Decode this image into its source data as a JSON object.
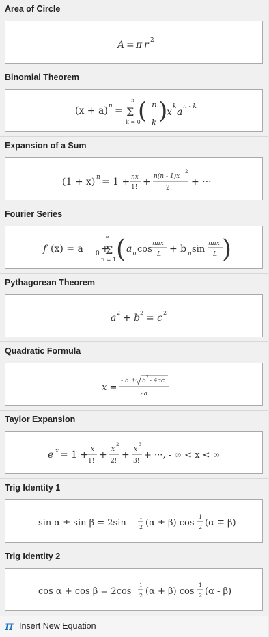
{
  "sections": [
    {
      "title": "Area of Circle"
    },
    {
      "title": "Binomial Theorem"
    },
    {
      "title": "Expansion of a Sum"
    },
    {
      "title": "Fourier Series"
    },
    {
      "title": "Pythagorean Theorem"
    },
    {
      "title": "Quadratic Formula"
    },
    {
      "title": "Taylor Expansion"
    },
    {
      "title": "Trig Identity 1"
    },
    {
      "title": "Trig Identity 2"
    }
  ],
  "equations": {
    "area": {
      "A": "A",
      "eq": "=",
      "pi": "π",
      "r": "r",
      "sq": "2"
    },
    "binomial": {
      "lhs": "(x + a)",
      "n": "n",
      "eq": "=",
      "sigma": "Σ",
      "top": "n",
      "bottom": "k = 0",
      "binom_n": "n",
      "binom_k": "k",
      "x": "x",
      "xexp": "k",
      "a": "a",
      "aexp": "n - k",
      "lp": "(",
      "rp": ")"
    },
    "expansion": {
      "lhs": "(1 + x)",
      "n": "n",
      "eq": "= 1 +",
      "f1n": "nx",
      "f1d": "1!",
      "plus": "+",
      "f2n": "n(n - 1)x",
      "f2sq": "2",
      "f2d": "2!",
      "tail": "+ ···"
    },
    "fourier": {
      "f": "f",
      "arg": "(x) = a",
      "sub0": "0",
      "plus": "+",
      "sigma": "Σ",
      "top": "∞",
      "bottom": "n = 1",
      "a": "a",
      "subn": "n",
      "cos": "cos",
      "frac_n": "nπx",
      "frac_d": "L",
      "plus2": "+ b",
      "subn2": "n",
      "sin": "sin",
      "frac2_n": "nπx",
      "frac2_d": "L",
      "lp": "(",
      "rp": ")"
    },
    "pythagorean": {
      "a": "a",
      "two1": "2",
      "plus": "+ b",
      "two2": "2",
      "eq": "= c",
      "two3": "2"
    },
    "quadratic": {
      "x": "x =",
      "num": "- b ±",
      "rad": "b",
      "radsq": "2",
      "radrest": "- 4ac",
      "den": "2a"
    },
    "taylor": {
      "e": "e",
      "x": "x",
      "eq": "= 1 +",
      "f1n": "x",
      "f1d": "1!",
      "plus": "+",
      "f2n": "x",
      "f2e": "2",
      "f2d": "2!",
      "f3n": "x",
      "f3e": "3",
      "f3d": "3!",
      "tail": "+ ···, - ∞ < x < ∞"
    },
    "trig1": {
      "lhs": "sin α ± sin β = 2sin",
      "h1n": "1",
      "h1d": "2",
      "mid": "(α ± β) cos",
      "h2n": "1",
      "h2d": "2",
      "end": "(α ∓ β)"
    },
    "trig2": {
      "lhs": "cos α + cos β = 2cos",
      "h1n": "1",
      "h1d": "2",
      "mid": "(α + β) cos",
      "h2n": "1",
      "h2d": "2",
      "end": "(α - β)"
    }
  },
  "footer": {
    "icon": "π",
    "label": "Insert New Equation"
  }
}
